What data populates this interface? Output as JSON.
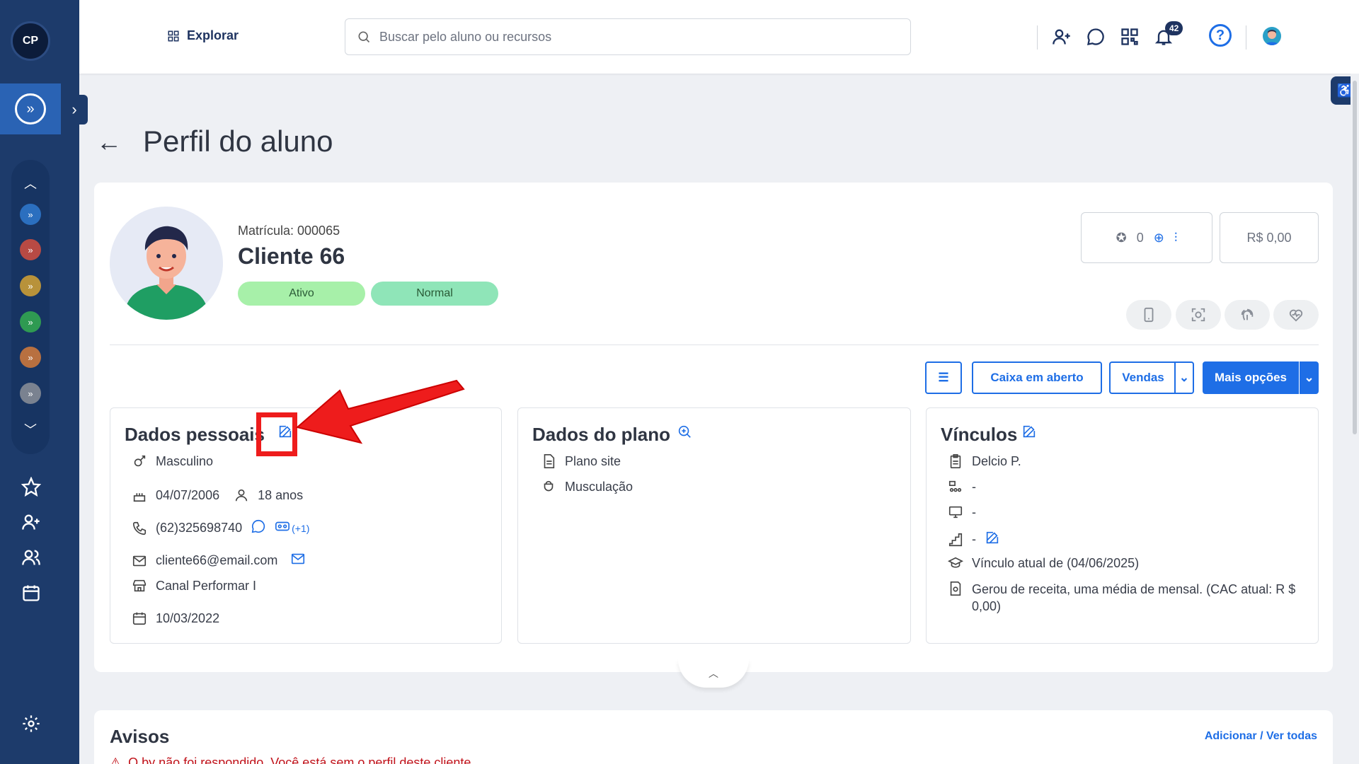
{
  "app": {
    "logo_text": "CP"
  },
  "topbar": {
    "explorar_label": "Explorar",
    "search_placeholder": "Buscar pelo aluno ou recursos",
    "notifications_count": "42",
    "help_label": "?"
  },
  "page": {
    "title": "Perfil do aluno"
  },
  "profile": {
    "matricula": "Matrícula: 000065",
    "name": "Cliente 66",
    "status_badges": [
      "Ativo",
      "Normal"
    ],
    "points": "0",
    "balance": "R$ 0,00"
  },
  "actions": {
    "caixa": "Caixa em aberto",
    "vendas": "Vendas",
    "mais_opcoes": "Mais opções"
  },
  "dados_pessoais": {
    "title": "Dados pessoais",
    "gender": "Masculino",
    "birthdate": "04/07/2006",
    "age": "18 anos",
    "phone": "(62)325698740",
    "phone_extra": "(+1)",
    "email": "cliente66@email.com",
    "channel": "Canal Performar I",
    "registration_date": "10/03/2022"
  },
  "dados_plano": {
    "title": "Dados do plano",
    "plan": "Plano site",
    "modality": "Musculação"
  },
  "vinculos": {
    "title": "Vínculos",
    "consultant": "Delcio P.",
    "dash1": "-",
    "dash2": "-",
    "dash3": "-",
    "vinculo_atual": "Vínculo atual de (04/06/2025)",
    "receita": "Gerou de receita, uma média de mensal. (CAC atual: R $ 0,00)"
  },
  "avisos": {
    "title": "Avisos",
    "link": "Adicionar / Ver todas",
    "warning": "O by não foi respondido. Você está sem o perfil deste cliente"
  },
  "colors": {
    "primary": "#1e6ee6",
    "sidebar": "#1d3b6b",
    "annotation": "#ee1c1c"
  }
}
